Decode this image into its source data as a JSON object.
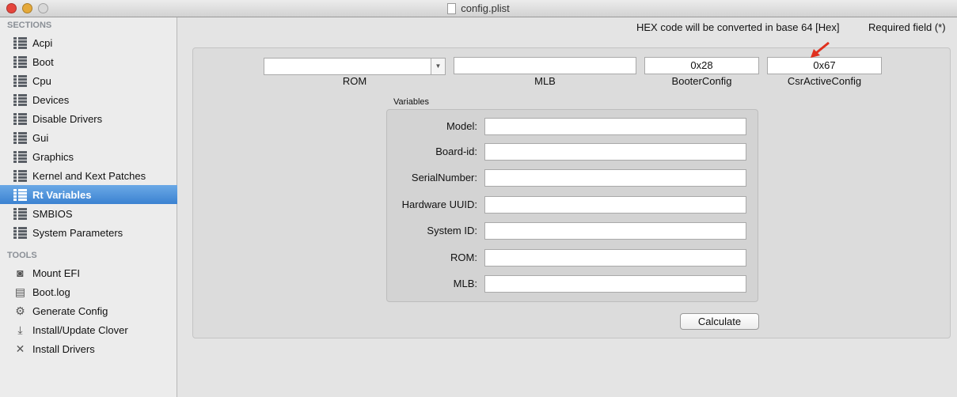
{
  "window": {
    "title": "config.plist"
  },
  "sidebar": {
    "sections_header": "SECTIONS",
    "sections": [
      {
        "label": "Acpi"
      },
      {
        "label": "Boot"
      },
      {
        "label": "Cpu"
      },
      {
        "label": "Devices"
      },
      {
        "label": "Disable Drivers"
      },
      {
        "label": "Gui"
      },
      {
        "label": "Graphics"
      },
      {
        "label": "Kernel and Kext Patches"
      },
      {
        "label": "Rt Variables",
        "selected": true
      },
      {
        "label": "SMBIOS"
      },
      {
        "label": "System Parameters"
      }
    ],
    "tools_header": "TOOLS",
    "tools": [
      {
        "label": "Mount EFI",
        "icon": "disk-icon"
      },
      {
        "label": "Boot.log",
        "icon": "log-icon"
      },
      {
        "label": "Generate Config",
        "icon": "gear-icon"
      },
      {
        "label": "Install/Update Clover",
        "icon": "download-icon"
      },
      {
        "label": "Install Drivers",
        "icon": "wrench-icon"
      }
    ]
  },
  "main": {
    "hex_note": "HEX code will be converted in base 64 [Hex]",
    "required_note": "Required field (*)",
    "top_fields": {
      "rom": {
        "label": "ROM",
        "value": ""
      },
      "mlb": {
        "label": "MLB",
        "value": ""
      },
      "booter_config": {
        "label": "BooterConfig",
        "value": "0x28"
      },
      "csr_active_config": {
        "label": "CsrActiveConfig",
        "value": "0x67"
      }
    },
    "variables": {
      "title": "Variables",
      "rows": [
        {
          "label": "Model:",
          "value": ""
        },
        {
          "label": "Board-id:",
          "value": ""
        },
        {
          "label": "SerialNumber:",
          "value": ""
        },
        {
          "label": "Hardware UUID:",
          "value": ""
        },
        {
          "label": "System ID:",
          "value": ""
        },
        {
          "label": "ROM:",
          "value": ""
        },
        {
          "label": "MLB:",
          "value": ""
        }
      ]
    },
    "calculate_label": "Calculate"
  },
  "colors": {
    "selection": "#3b82d1",
    "annotation_arrow": "#e0301e"
  }
}
